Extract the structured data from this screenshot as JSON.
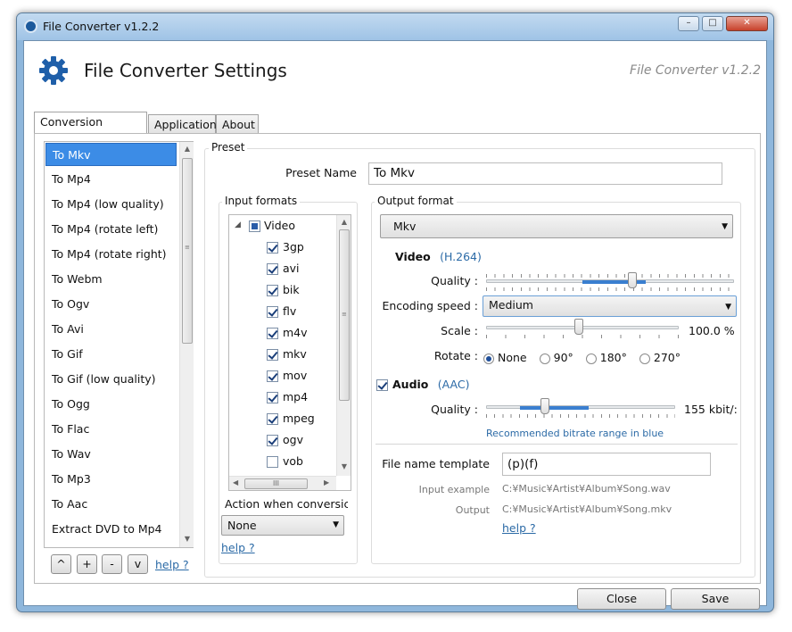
{
  "window": {
    "title": "File Converter v1.2.2",
    "buttons": {
      "minimize": "–",
      "maximize": "□",
      "close": "✕"
    }
  },
  "header": {
    "title": "File Converter Settings",
    "version": "File Converter v1.2.2",
    "icon": "gear-icon"
  },
  "tabs": [
    "Conversion Presets",
    "Application",
    "About"
  ],
  "presets": [
    "To Mkv",
    "To Mp4",
    "To Mp4 (low quality)",
    "To Mp4 (rotate left)",
    "To Mp4 (rotate right)",
    "To Webm",
    "To Ogv",
    "To Avi",
    "To Gif",
    "To Gif (low quality)",
    "To Ogg",
    "To Flac",
    "To Wav",
    "To Mp3",
    "To Aac",
    "Extract DVD to Mp4"
  ],
  "preset_buttons": {
    "up": "^",
    "add": "+",
    "remove": "-",
    "down": "v",
    "help": "help ?"
  },
  "preset": {
    "group_label": "Preset",
    "name_label": "Preset Name",
    "name_value": "To Mkv",
    "input_formats_label": "Input formats",
    "tree_root": "Video",
    "formats": [
      {
        "name": "3gp",
        "checked": true
      },
      {
        "name": "avi",
        "checked": true
      },
      {
        "name": "bik",
        "checked": true
      },
      {
        "name": "flv",
        "checked": true
      },
      {
        "name": "m4v",
        "checked": true
      },
      {
        "name": "mkv",
        "checked": true
      },
      {
        "name": "mov",
        "checked": true
      },
      {
        "name": "mp4",
        "checked": true
      },
      {
        "name": "mpeg",
        "checked": true
      },
      {
        "name": "ogv",
        "checked": true
      },
      {
        "name": "vob",
        "checked": false
      }
    ],
    "hscroll_grip": "III",
    "action_label": "Action when conversic",
    "action_value": "None",
    "help": "help ?"
  },
  "output": {
    "label": "Output format",
    "format": "Mkv",
    "video_label": "Video",
    "video_codec": "(H.264)",
    "quality_label": "Quality :",
    "encoding_speed_label": "Encoding speed :",
    "encoding_speed_value": "Medium",
    "scale_label": "Scale :",
    "scale_value": "100.0 %",
    "rotate_label": "Rotate :",
    "rotate_options": [
      "None",
      "90°",
      "180°",
      "270°"
    ],
    "rotate_selected": "None",
    "audio_label": "Audio",
    "audio_codec": "(AAC)",
    "audio_quality_label": "Quality :",
    "audio_quality_value": "155 kbit/:",
    "bitrate_note": "Recommended bitrate range in blue",
    "template_label": "File name template",
    "template_value": "(p)(f)",
    "input_example_label": "Input example",
    "input_example_value": "C:¥Music¥Artist¥Album¥Song.wav",
    "output_example_label": "Output",
    "output_example_value": "C:¥Music¥Artist¥Album¥Song.mkv",
    "help": "help ?"
  },
  "footer": {
    "close": "Close",
    "save": "Save"
  }
}
